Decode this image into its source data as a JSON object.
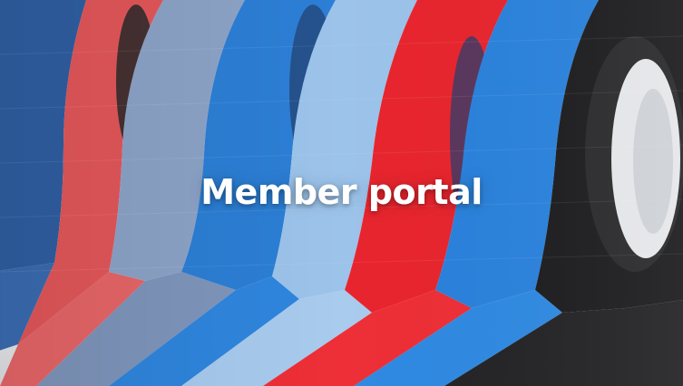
{
  "hero": {
    "title": "Member portal",
    "image_subject": "tape-rolls-photo",
    "tape_colors": [
      "#2f5fa3",
      "#e4575a",
      "#8da4c8",
      "#2c7fd6",
      "#9cc3ea",
      "#e8252e",
      "#2a82dc",
      "#1d1d1f"
    ]
  }
}
